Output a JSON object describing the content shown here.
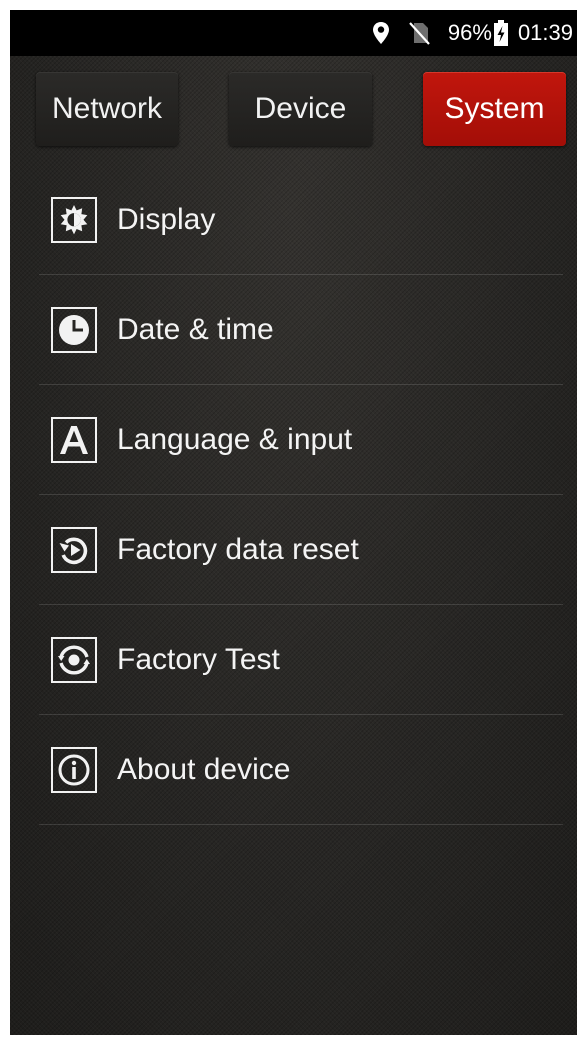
{
  "status_bar": {
    "icons": [
      "location-pin-icon",
      "no-sim-icon",
      "battery-charging-icon"
    ],
    "battery_percent": "96%",
    "time": "01:39"
  },
  "tabs": [
    {
      "label": "Network",
      "active": false
    },
    {
      "label": "Device",
      "active": false
    },
    {
      "label": "System",
      "active": true
    }
  ],
  "menu": {
    "items": [
      {
        "label": "Display",
        "icon": "display-brightness-icon"
      },
      {
        "label": "Date & time",
        "icon": "clock-icon"
      },
      {
        "label": "Language & input",
        "icon": "language-a-icon"
      },
      {
        "label": "Factory data reset",
        "icon": "reset-icon"
      },
      {
        "label": "Factory Test",
        "icon": "factory-test-icon"
      },
      {
        "label": "About device",
        "icon": "info-icon"
      }
    ]
  },
  "colors": {
    "active_tab": "#b3120a",
    "background": "#262523",
    "status_bar": "#000000",
    "text": "#f4f4f4"
  }
}
